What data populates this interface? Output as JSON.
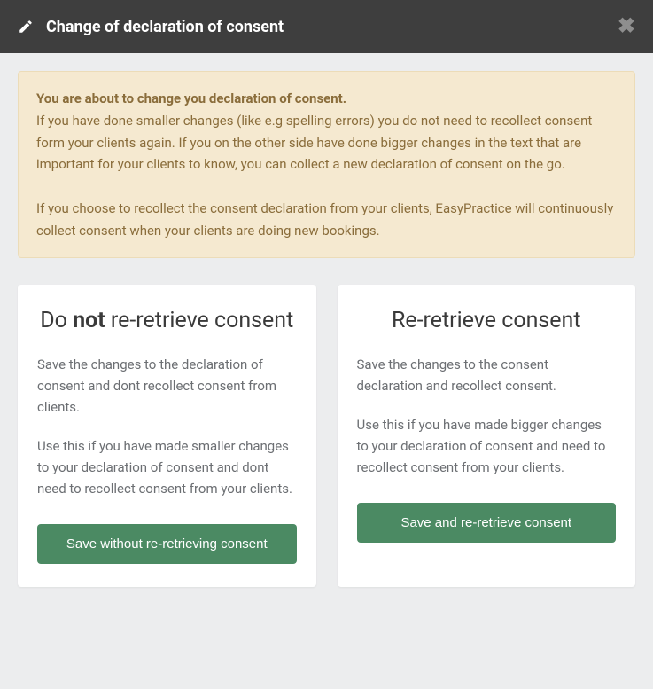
{
  "header": {
    "title": "Change of declaration of consent"
  },
  "alert": {
    "bold_line": "You are about to change you declaration of consent.",
    "para1": "If you have done smaller changes (like e.g spelling errors) you do not need to recollect consent form your clients again. If you on the other side have done bigger changes in the text that are important for your clients to know, you can collect a new declaration of consent on the go.",
    "para2": "If you choose to recollect the consent declaration from your clients, EasyPractice will continuously collect consent when your clients are doing new bookings."
  },
  "card_no_retrieve": {
    "title_prefix": "Do ",
    "title_bold": "not",
    "title_suffix": " re-retrieve consent",
    "desc1": "Save the changes to the declaration of consent and dont recollect consent from clients.",
    "desc2": "Use this if you have made smaller changes to your declaration of consent and dont need to recollect consent from your clients.",
    "button_label": "Save without re-retrieving consent"
  },
  "card_retrieve": {
    "title": "Re-retrieve consent",
    "desc1": "Save the changes to the consent declaration and recollect consent.",
    "desc2": "Use this if you have made bigger changes to your declaration of consent and need to recollect consent from your clients.",
    "button_label": "Save and re-retrieve consent"
  }
}
